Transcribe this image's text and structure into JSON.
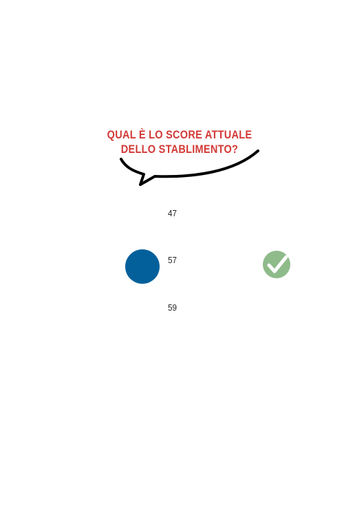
{
  "question": {
    "line1": "QUAL È LO SCORE ATTUALE",
    "line2": "DELLO STABLIMENTO?"
  },
  "options": [
    {
      "label": "47",
      "selected": false
    },
    {
      "label": "57",
      "selected": true
    },
    {
      "label": "59",
      "selected": false
    }
  ],
  "icons": {
    "selection": "filled-circle-icon",
    "correct": "check-circle-icon"
  },
  "colors": {
    "question": "#d23a36",
    "selected_dot": "#03609b",
    "check_badge": "#8fbb8a",
    "text": "#222222",
    "bubble_stroke": "#000000"
  }
}
